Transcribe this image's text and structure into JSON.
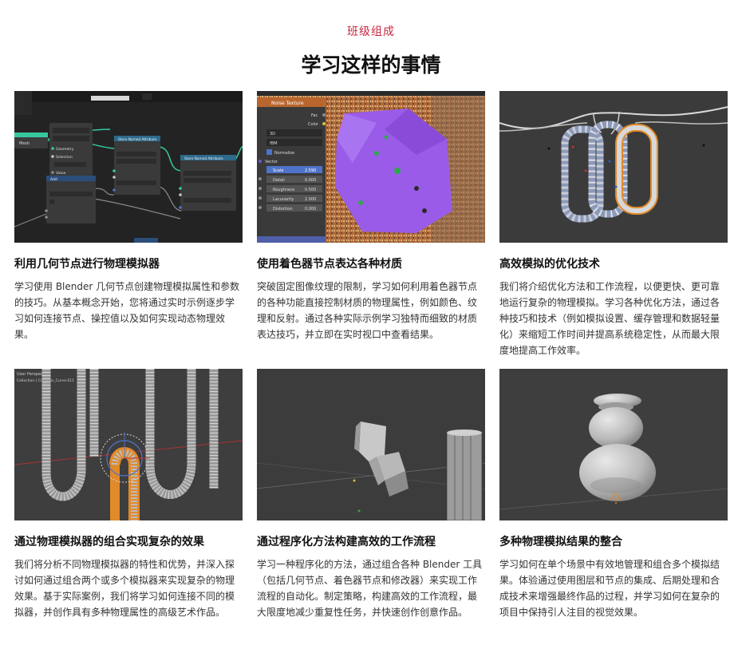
{
  "header": {
    "eyebrow": "班级组成",
    "title": "学习这样的事情"
  },
  "cards": [
    {
      "title": "利用几何节点进行物理模拟器",
      "desc": "学习使用 Blender 几何节点创建物理模拟属性和参数的技巧。从基本概念开始，您将通过实时示例逐步学习如何连接节点、操控值以及如何实现动态物理效果。",
      "thumb_labels": [
        "Mesh",
        "Store Named Attribute",
        "Geometry",
        "Selection",
        "Value",
        "Add",
        "Store Named Attribute"
      ]
    },
    {
      "title": "使用着色器节点表达各种材质",
      "desc": "突破固定图像纹理的限制，学习如何利用着色器节点的各种功能直接控制材质的物理属性，例如颜色、纹理和反射。通过各种实际示例学习独特而细致的材质表达技巧，并立即在实时视口中查看结果。",
      "thumb_labels": [
        "Noise Texture",
        "Fac",
        "Color",
        "3D",
        "fBM",
        "Normalize",
        "Vector",
        "Scale",
        "2.590",
        "Detail",
        "0.000",
        "Roughness",
        "0.500",
        "Lacunarity",
        "2.000",
        "Distortion",
        "0.000"
      ]
    },
    {
      "title": "高效模拟的优化技术",
      "desc": "我们将介绍优化方法和工作流程，以便更快、更可靠地运行复杂的物理模拟。学习各种优化方法，通过各种技巧和技术（例如模拟设置、缓存管理和数据轻量化）来缩短工作时间并提高系统稳定性，从而最大限度地提高工作效率。",
      "thumb_labels": []
    },
    {
      "title": "通过物理模拟器的组合实现复杂的效果",
      "desc": "我们将分析不同物理模拟器的特性和优势，并深入探讨如何通过组合两个或多个模拟器来实现复杂的物理效果。基于实际案例，我们将学习如何连接不同的模拟器，并创作具有多种物理属性的高级艺术作品。",
      "thumb_labels": [
        "User Perspective",
        "Collection | Crossbar_Curve.011"
      ]
    },
    {
      "title": "通过程序化方法构建高效的工作流程",
      "desc": "学习一种程序化的方法，通过组合各种 Blender 工具（包括几何节点、着色器节点和修改器）来实现工作流程的自动化。制定策略，构建高效的工作流程，最大限度地减少重复性任务，并快速创作创意作品。",
      "thumb_labels": []
    },
    {
      "title": "多种物理模拟结果的整合",
      "desc": "学习如何在单个场景中有效地管理和组合多个模拟结果。体验通过使用图层和节点的集成、后期处理和合成技术来增强最终作品的过程，并学习如何在复杂的项目中保持引人注目的视觉效果。",
      "thumb_labels": []
    }
  ],
  "colors": {
    "accent": "#c8263e",
    "node_green": "#37c8a0",
    "node_blue": "#4f73c8",
    "noise_purple": "#9a5ce8",
    "viewport_grey": "#3d3d3d"
  }
}
